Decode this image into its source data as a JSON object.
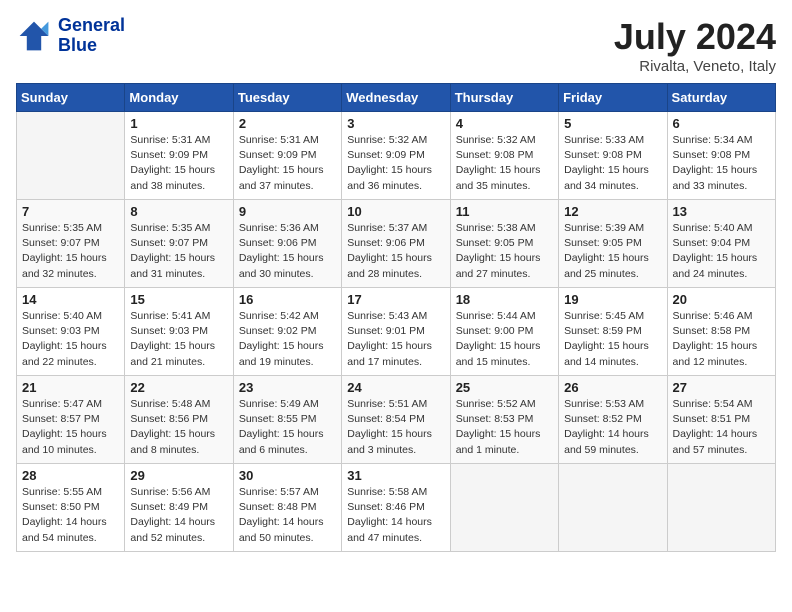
{
  "header": {
    "logo_line1": "General",
    "logo_line2": "Blue",
    "month_year": "July 2024",
    "location": "Rivalta, Veneto, Italy"
  },
  "days_of_week": [
    "Sunday",
    "Monday",
    "Tuesday",
    "Wednesday",
    "Thursday",
    "Friday",
    "Saturday"
  ],
  "weeks": [
    [
      {
        "day": "",
        "content": ""
      },
      {
        "day": "1",
        "content": "Sunrise: 5:31 AM\nSunset: 9:09 PM\nDaylight: 15 hours\nand 38 minutes."
      },
      {
        "day": "2",
        "content": "Sunrise: 5:31 AM\nSunset: 9:09 PM\nDaylight: 15 hours\nand 37 minutes."
      },
      {
        "day": "3",
        "content": "Sunrise: 5:32 AM\nSunset: 9:09 PM\nDaylight: 15 hours\nand 36 minutes."
      },
      {
        "day": "4",
        "content": "Sunrise: 5:32 AM\nSunset: 9:08 PM\nDaylight: 15 hours\nand 35 minutes."
      },
      {
        "day": "5",
        "content": "Sunrise: 5:33 AM\nSunset: 9:08 PM\nDaylight: 15 hours\nand 34 minutes."
      },
      {
        "day": "6",
        "content": "Sunrise: 5:34 AM\nSunset: 9:08 PM\nDaylight: 15 hours\nand 33 minutes."
      }
    ],
    [
      {
        "day": "7",
        "content": "Sunrise: 5:35 AM\nSunset: 9:07 PM\nDaylight: 15 hours\nand 32 minutes."
      },
      {
        "day": "8",
        "content": "Sunrise: 5:35 AM\nSunset: 9:07 PM\nDaylight: 15 hours\nand 31 minutes."
      },
      {
        "day": "9",
        "content": "Sunrise: 5:36 AM\nSunset: 9:06 PM\nDaylight: 15 hours\nand 30 minutes."
      },
      {
        "day": "10",
        "content": "Sunrise: 5:37 AM\nSunset: 9:06 PM\nDaylight: 15 hours\nand 28 minutes."
      },
      {
        "day": "11",
        "content": "Sunrise: 5:38 AM\nSunset: 9:05 PM\nDaylight: 15 hours\nand 27 minutes."
      },
      {
        "day": "12",
        "content": "Sunrise: 5:39 AM\nSunset: 9:05 PM\nDaylight: 15 hours\nand 25 minutes."
      },
      {
        "day": "13",
        "content": "Sunrise: 5:40 AM\nSunset: 9:04 PM\nDaylight: 15 hours\nand 24 minutes."
      }
    ],
    [
      {
        "day": "14",
        "content": "Sunrise: 5:40 AM\nSunset: 9:03 PM\nDaylight: 15 hours\nand 22 minutes."
      },
      {
        "day": "15",
        "content": "Sunrise: 5:41 AM\nSunset: 9:03 PM\nDaylight: 15 hours\nand 21 minutes."
      },
      {
        "day": "16",
        "content": "Sunrise: 5:42 AM\nSunset: 9:02 PM\nDaylight: 15 hours\nand 19 minutes."
      },
      {
        "day": "17",
        "content": "Sunrise: 5:43 AM\nSunset: 9:01 PM\nDaylight: 15 hours\nand 17 minutes."
      },
      {
        "day": "18",
        "content": "Sunrise: 5:44 AM\nSunset: 9:00 PM\nDaylight: 15 hours\nand 15 minutes."
      },
      {
        "day": "19",
        "content": "Sunrise: 5:45 AM\nSunset: 8:59 PM\nDaylight: 15 hours\nand 14 minutes."
      },
      {
        "day": "20",
        "content": "Sunrise: 5:46 AM\nSunset: 8:58 PM\nDaylight: 15 hours\nand 12 minutes."
      }
    ],
    [
      {
        "day": "21",
        "content": "Sunrise: 5:47 AM\nSunset: 8:57 PM\nDaylight: 15 hours\nand 10 minutes."
      },
      {
        "day": "22",
        "content": "Sunrise: 5:48 AM\nSunset: 8:56 PM\nDaylight: 15 hours\nand 8 minutes."
      },
      {
        "day": "23",
        "content": "Sunrise: 5:49 AM\nSunset: 8:55 PM\nDaylight: 15 hours\nand 6 minutes."
      },
      {
        "day": "24",
        "content": "Sunrise: 5:51 AM\nSunset: 8:54 PM\nDaylight: 15 hours\nand 3 minutes."
      },
      {
        "day": "25",
        "content": "Sunrise: 5:52 AM\nSunset: 8:53 PM\nDaylight: 15 hours\nand 1 minute."
      },
      {
        "day": "26",
        "content": "Sunrise: 5:53 AM\nSunset: 8:52 PM\nDaylight: 14 hours\nand 59 minutes."
      },
      {
        "day": "27",
        "content": "Sunrise: 5:54 AM\nSunset: 8:51 PM\nDaylight: 14 hours\nand 57 minutes."
      }
    ],
    [
      {
        "day": "28",
        "content": "Sunrise: 5:55 AM\nSunset: 8:50 PM\nDaylight: 14 hours\nand 54 minutes."
      },
      {
        "day": "29",
        "content": "Sunrise: 5:56 AM\nSunset: 8:49 PM\nDaylight: 14 hours\nand 52 minutes."
      },
      {
        "day": "30",
        "content": "Sunrise: 5:57 AM\nSunset: 8:48 PM\nDaylight: 14 hours\nand 50 minutes."
      },
      {
        "day": "31",
        "content": "Sunrise: 5:58 AM\nSunset: 8:46 PM\nDaylight: 14 hours\nand 47 minutes."
      },
      {
        "day": "",
        "content": ""
      },
      {
        "day": "",
        "content": ""
      },
      {
        "day": "",
        "content": ""
      }
    ]
  ]
}
